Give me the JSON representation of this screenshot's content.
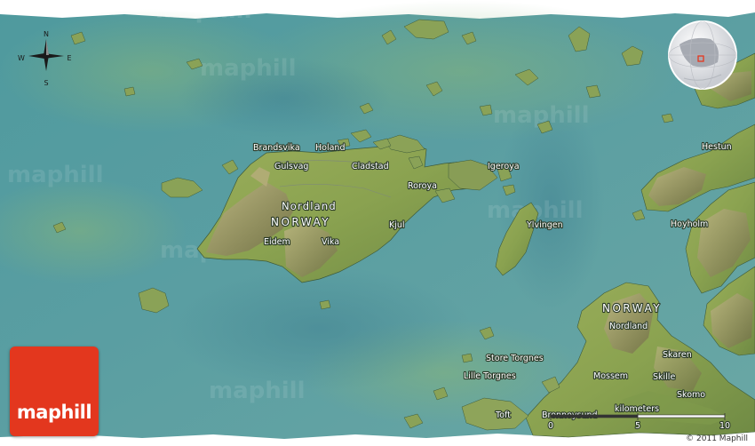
{
  "compass": {
    "n": "N",
    "s": "S",
    "e": "E",
    "w": "W"
  },
  "labels": {
    "region": "Nordland",
    "country": "NORWAY",
    "region_se": "Nordland",
    "country_se": "NORWAY",
    "places": {
      "brandsvika": "Brandsvika",
      "holand": "Holand",
      "gulsvag": "Gulsvag",
      "cladstad": "Cladstad",
      "igeroya": "Igeroya",
      "roroya": "Roroya",
      "kjul": "Kjul",
      "eidem": "Eidem",
      "vika": "Vika",
      "ylvingen": "Ylvingen",
      "hestun": "Hestun",
      "hoyholm": "Hoyholm",
      "store_torgnes": "Store Torgnes",
      "lille_torgnes": "Lille Torgnes",
      "mossem": "Mossem",
      "skaren": "Skaren",
      "skille": "Skille",
      "skomo": "Skomo",
      "toft": "Toft",
      "bronnoysund": "Bronnoysund"
    }
  },
  "scale": {
    "unit": "kilometers",
    "ticks": [
      "0",
      "5",
      "10"
    ]
  },
  "logo_text": "maphill",
  "copyright": "© 2011 Maphill",
  "watermark": "maphill"
}
